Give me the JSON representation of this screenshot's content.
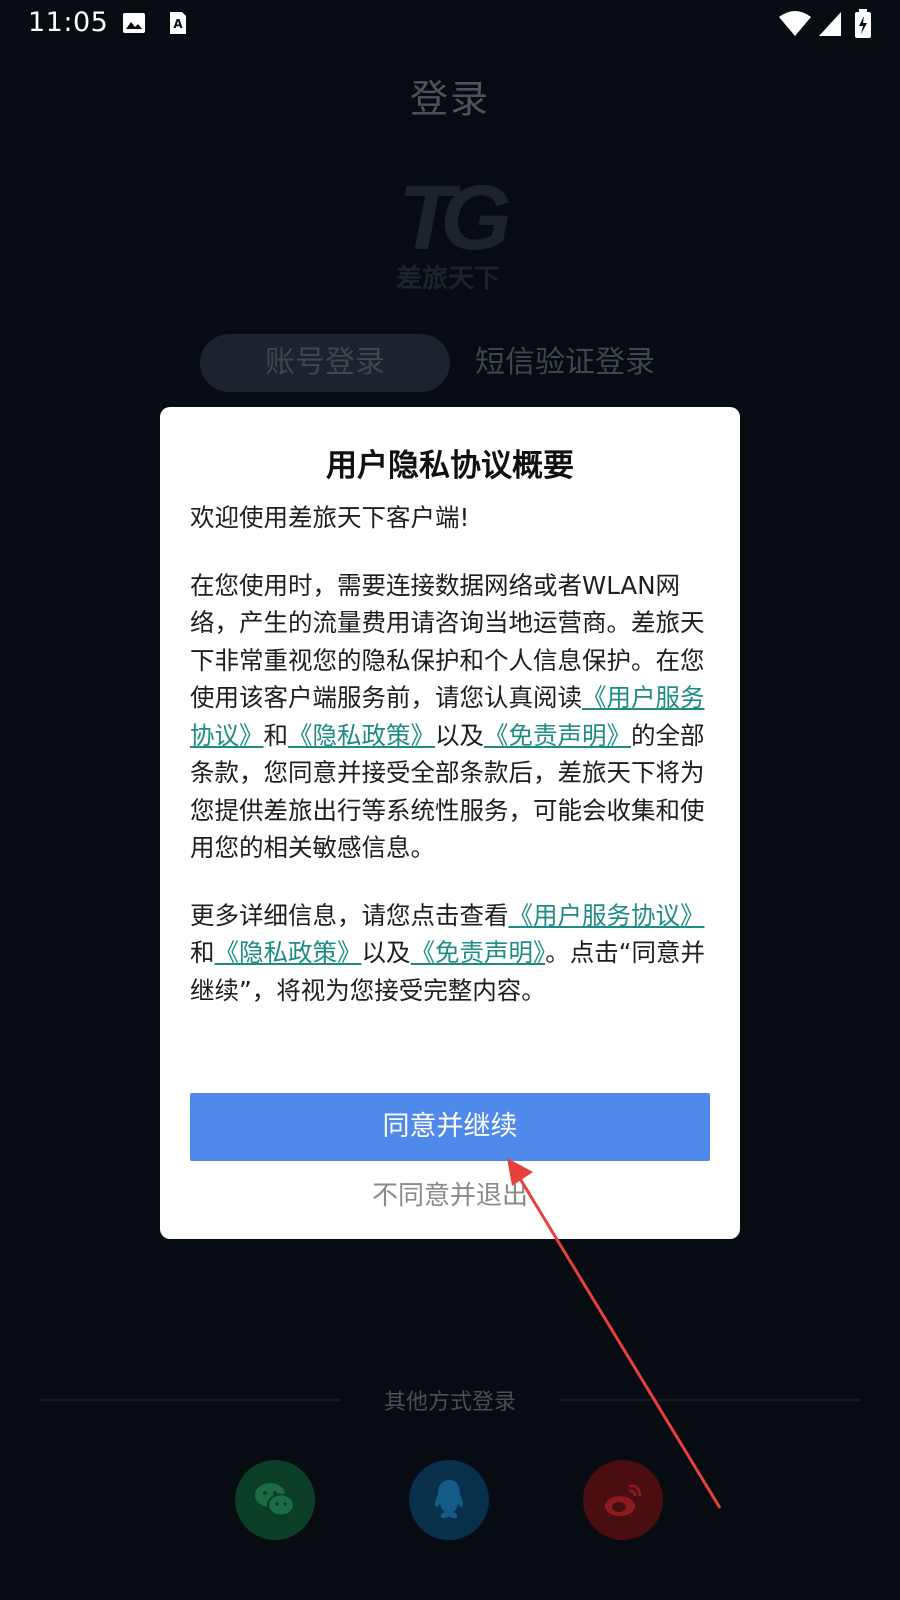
{
  "status_bar": {
    "time": "11:05",
    "icons": [
      "image-icon",
      "a-text-icon",
      "wifi-icon",
      "signal-icon",
      "battery-icon"
    ]
  },
  "login_page": {
    "title": "登录",
    "logo_text": "TG",
    "logo_subtext": "差旅天下",
    "tabs": [
      {
        "label": "账号登录",
        "active": true
      },
      {
        "label": "短信验证登录",
        "active": false
      }
    ],
    "other_login_label": "其他方式登录",
    "social_logins": [
      "wechat-icon",
      "qq-icon",
      "weibo-icon"
    ]
  },
  "dialog": {
    "title": "用户隐私协议概要",
    "welcome": "欢迎使用差旅天下客户端!",
    "para2": {
      "text1": "在您使用时，需要连接数据网络或者WLAN网络，产生的流量费用请咨询当地运营商。差旅天下非常重视您的隐私保护和个人信息保护。在您使用该客户端服务前，请您认真阅读",
      "link1": "《用户服务协议》",
      "text2": "和",
      "link2": "《隐私政策》",
      "text3": "以及",
      "link3": "《免责声明》",
      "text4": "的全部条款，您同意并接受全部条款后，差旅天下将为您提供差旅出行等系统性服务，可能会收集和使用您的相关敏感信息。"
    },
    "para3": {
      "text1": "更多详细信息，请您点击查看",
      "link1": "《用户服务协议》",
      "text2": "和",
      "link2": "《隐私政策》",
      "text3": "以及",
      "link3": "《免责声明》",
      "text4": "。点击“同意并继续”，将视为您接受完整内容。"
    },
    "agree_label": "同意并继续",
    "decline_label": "不同意并退出"
  },
  "colors": {
    "background": "#070b12",
    "agree_button": "#5089ec",
    "link": "#1f8c84",
    "annotation_arrow": "#e8403a"
  }
}
